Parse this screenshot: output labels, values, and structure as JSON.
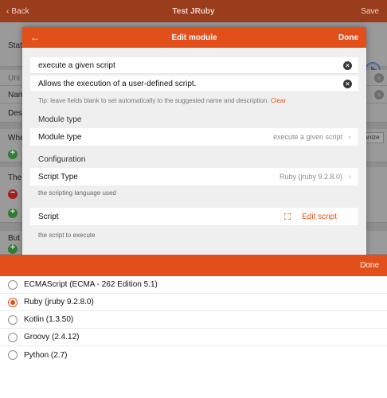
{
  "app": {
    "back_label": "Back",
    "title": "Test JRuby",
    "save_label": "Save"
  },
  "background": {
    "stat_label": "Stat",
    "uni_label": "Uni",
    "nam_label": "Nam",
    "des_label": "Des",
    "whe_label": "Whe",
    "the_label": "The",
    "but_label": "But",
    "organize_label": "anize"
  },
  "modal": {
    "title": "Edit module",
    "done_label": "Done",
    "name_value": "execute a given script",
    "description_value": "Allows the execution of a user-defined script.",
    "tip_text": "Tip: leave fields blank to set automatically to the suggested name and description.",
    "clear_label": "Clear",
    "module_type_section": "Module type",
    "module_type_label": "Module type",
    "module_type_value": "execute a given script",
    "configuration_section": "Configuration",
    "script_type_label": "Script Type",
    "script_type_value": "Ruby (jruby 9.2.8.0)",
    "script_type_desc": "the scripting language used",
    "script_label": "Script",
    "edit_script_label": "Edit script",
    "script_desc": "the script to execute"
  },
  "picker": {
    "done_label": "Done",
    "options": [
      {
        "label": "ECMAScript (ECMA - 262 Edition 5.1)",
        "selected": false
      },
      {
        "label": "Ruby (jruby 9.2.8.0)",
        "selected": true
      },
      {
        "label": "Kotlin (1.3.50)",
        "selected": false
      },
      {
        "label": "Groovy (2.4.12)",
        "selected": false
      },
      {
        "label": "Python (2.7)",
        "selected": false
      }
    ]
  },
  "colors": {
    "accent": "#e34f1a",
    "topbar_dimmed": "#9a3d1c"
  }
}
